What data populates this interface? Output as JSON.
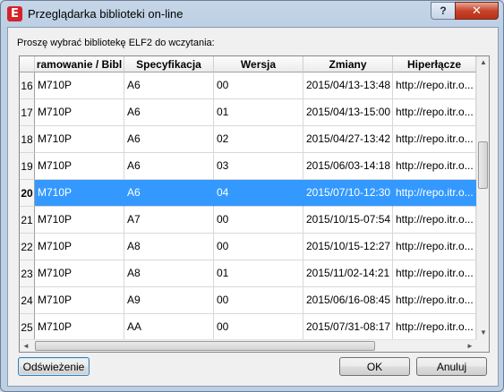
{
  "window": {
    "title": "Przeglądarka biblioteki on-line",
    "app_icon_glyph": "E",
    "help_glyph": "?",
    "close_glyph": "✕"
  },
  "prompt": "Proszę wybrać bibliotekę ELF2 do wczytania:",
  "table": {
    "columns": [
      "ramowanie / Bibl",
      "Specyfikacja",
      "Wersja",
      "Zmiany",
      "Hiperłącze"
    ],
    "selected_row_number": "20",
    "rows": [
      {
        "num": "16",
        "cells": [
          "M710P",
          "A6",
          "00",
          "2015/04/13-13:48",
          "http://repo.itr.o..."
        ]
      },
      {
        "num": "17",
        "cells": [
          "M710P",
          "A6",
          "01",
          "2015/04/13-15:00",
          "http://repo.itr.o..."
        ]
      },
      {
        "num": "18",
        "cells": [
          "M710P",
          "A6",
          "02",
          "2015/04/27-13:42",
          "http://repo.itr.o..."
        ]
      },
      {
        "num": "19",
        "cells": [
          "M710P",
          "A6",
          "03",
          "2015/06/03-14:18",
          "http://repo.itr.o..."
        ]
      },
      {
        "num": "20",
        "cells": [
          "M710P",
          "A6",
          "04",
          "2015/07/10-12:30",
          "http://repo.itr.o..."
        ]
      },
      {
        "num": "21",
        "cells": [
          "M710P",
          "A7",
          "00",
          "2015/10/15-07:54",
          "http://repo.itr.o..."
        ]
      },
      {
        "num": "22",
        "cells": [
          "M710P",
          "A8",
          "00",
          "2015/10/15-12:27",
          "http://repo.itr.o..."
        ]
      },
      {
        "num": "23",
        "cells": [
          "M710P",
          "A8",
          "01",
          "2015/11/02-14:21",
          "http://repo.itr.o..."
        ]
      },
      {
        "num": "24",
        "cells": [
          "M710P",
          "A9",
          "00",
          "2015/06/16-08:45",
          "http://repo.itr.o..."
        ]
      },
      {
        "num": "25",
        "cells": [
          "M710P",
          "AA",
          "00",
          "2015/07/31-08:17",
          "http://repo.itr.o..."
        ]
      }
    ]
  },
  "buttons": {
    "refresh": "Odświeżenie",
    "ok": "OK",
    "cancel": "Anuluj"
  },
  "scroll_glyphs": {
    "up": "▲",
    "down": "▼",
    "left": "◄",
    "right": "►"
  },
  "colors": {
    "selection": "#3399ff",
    "close_button": "#c8432b",
    "app_icon": "#d6232a"
  }
}
